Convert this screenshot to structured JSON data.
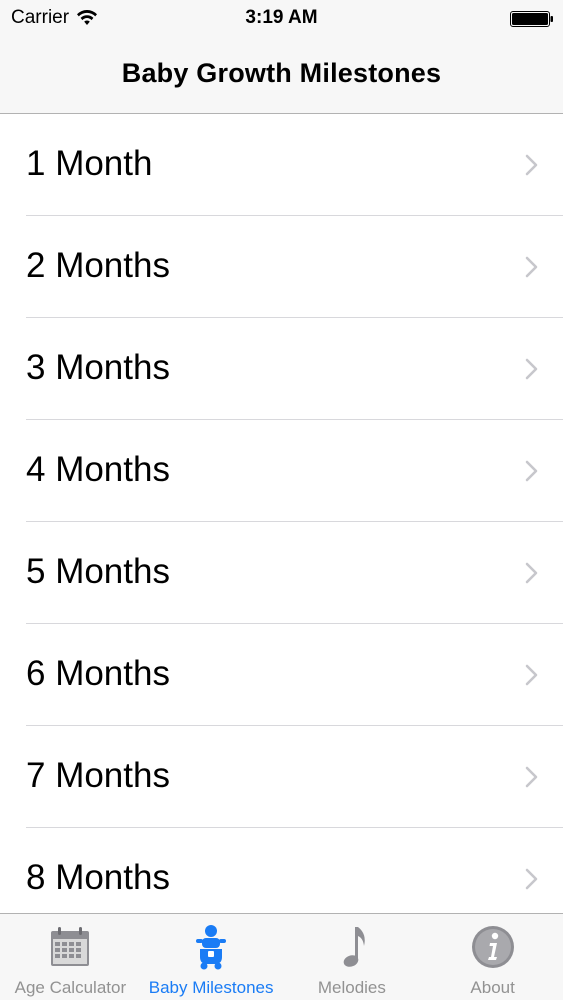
{
  "status_bar": {
    "carrier": "Carrier",
    "time": "3:19 AM",
    "wifi_icon": "wifi-icon",
    "battery_icon": "battery-icon"
  },
  "nav": {
    "title": "Baby Growth Milestones"
  },
  "list": {
    "items": [
      {
        "label": "1 Month"
      },
      {
        "label": "2 Months"
      },
      {
        "label": "3 Months"
      },
      {
        "label": "4 Months"
      },
      {
        "label": "5 Months"
      },
      {
        "label": "6 Months"
      },
      {
        "label": "7 Months"
      },
      {
        "label": "8 Months"
      }
    ],
    "accessory_icon": "chevron-right-icon"
  },
  "tabs": [
    {
      "label": "Age Calculator",
      "icon": "calendar-icon",
      "active": false
    },
    {
      "label": "Baby Milestones",
      "icon": "baby-icon",
      "active": true
    },
    {
      "label": "Melodies",
      "icon": "music-note-icon",
      "active": false
    },
    {
      "label": "About",
      "icon": "info-icon",
      "active": false
    }
  ],
  "colors": {
    "accent": "#1a7cf5",
    "inactive_tab": "#929292",
    "bar_background": "#f7f7f7",
    "separator": "#d8d8dc",
    "chevron": "#c7c7cc"
  }
}
